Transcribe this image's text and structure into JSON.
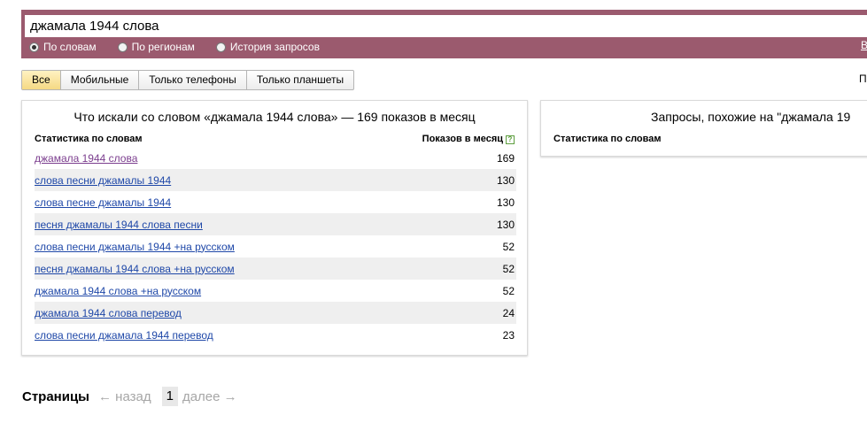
{
  "search": {
    "query": "джамала 1944 слова"
  },
  "modes": [
    {
      "label": "По словам",
      "checked": true
    },
    {
      "label": "По регионам",
      "checked": false
    },
    {
      "label": "История запросов",
      "checked": false
    }
  ],
  "band_link": "В",
  "filters": [
    {
      "label": "Все",
      "active": true
    },
    {
      "label": "Мобильные",
      "active": false
    },
    {
      "label": "Только телефоны",
      "active": false
    },
    {
      "label": "Только планшеты",
      "active": false
    }
  ],
  "right_cut_text": "П",
  "left_panel": {
    "title": "Что искали со словом «джамала 1944 слова» — 169 показов в месяц",
    "col_phrase": "Статистика по словам",
    "col_count": "Показов в месяц",
    "help": "?",
    "rows": [
      {
        "phrase": "джамала 1944 слова",
        "count": "169",
        "visited": true
      },
      {
        "phrase": "слова песни джамалы 1944",
        "count": "130",
        "visited": false
      },
      {
        "phrase": "слова песне джамалы 1944",
        "count": "130",
        "visited": false
      },
      {
        "phrase": "песня джамалы 1944 слова песни",
        "count": "130",
        "visited": false
      },
      {
        "phrase": "слова песни джамалы 1944 +на русском",
        "count": "52",
        "visited": false
      },
      {
        "phrase": "песня джамалы 1944 слова +на русском",
        "count": "52",
        "visited": false
      },
      {
        "phrase": "джамала 1944 слова +на русском",
        "count": "52",
        "visited": false
      },
      {
        "phrase": "джамала 1944 слова перевод",
        "count": "24",
        "visited": false
      },
      {
        "phrase": "слова песни джамала 1944 перевод",
        "count": "23",
        "visited": false
      }
    ]
  },
  "right_panel": {
    "title": "Запросы, похожие на \"джамала 19",
    "col_phrase": "Статистика по словам"
  },
  "pager": {
    "label": "Страницы",
    "prev": "← назад",
    "current": "1",
    "next": "далее →"
  }
}
